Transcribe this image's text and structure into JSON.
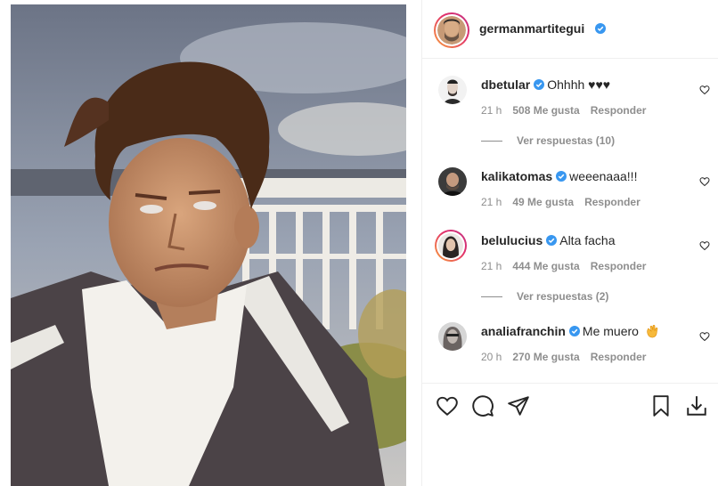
{
  "post": {
    "author": "germanmartitegui"
  },
  "comments": [
    {
      "username": "dbetular",
      "text": "Ohhhh ♥♥♥",
      "time": "21 h",
      "likes": "508 Me gusta",
      "reply": "Responder",
      "replies": "Ver respuestas (10)"
    },
    {
      "username": "kalikatomas",
      "text": "weeenaaa!!!",
      "time": "21 h",
      "likes": "49 Me gusta",
      "reply": "Responder"
    },
    {
      "username": "belulucius",
      "text": "Alta facha",
      "time": "21 h",
      "likes": "444 Me gusta",
      "reply": "Responder",
      "replies": "Ver respuestas (2)"
    },
    {
      "username": "analiafranchin",
      "text": "Me muero",
      "time": "20 h",
      "likes": "270 Me gusta",
      "reply": "Responder"
    }
  ],
  "icons": {
    "like": "heart-icon",
    "comment": "comment-icon",
    "share": "share-icon",
    "save": "bookmark-icon",
    "download": "download-icon",
    "verified": "verified-badge-icon",
    "emoji": "clapping-hands-icon"
  },
  "colors": {
    "verified": "#3897f0",
    "muted": "#8e8e8e",
    "text": "#262626",
    "border": "#efefef"
  }
}
